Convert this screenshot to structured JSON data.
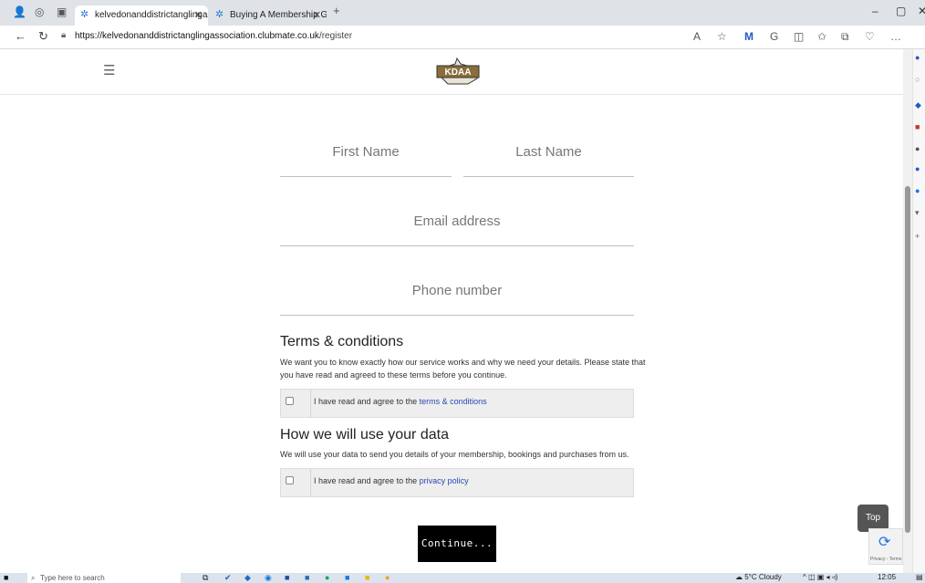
{
  "browser": {
    "tabs": [
      {
        "title": "kelvedonanddistrictanglingassoc"
      },
      {
        "title": "Buying A Membership Guide | C"
      }
    ],
    "new_tab": "+",
    "url_host": "https://kelvedonanddistrictanglingassociation.clubmate.co.uk",
    "url_path": "/register",
    "window": {
      "minimize": "–",
      "maximize": "▢",
      "close": "✕"
    }
  },
  "site": {
    "logo_text": "KDAA",
    "menu_icon": "hamburger-menu-icon"
  },
  "form": {
    "first_name_placeholder": "First Name",
    "last_name_placeholder": "Last Name",
    "email_placeholder": "Email address",
    "phone_placeholder": "Phone number"
  },
  "terms": {
    "heading": "Terms & conditions",
    "body": "We want you to know exactly how our service works and why we need your details. Please state that you have read and agreed to these terms before you continue.",
    "checkbox_prefix": "I have read and agree to the ",
    "checkbox_link": "terms & conditions",
    "checked": false
  },
  "data_use": {
    "heading": "How we will use your data",
    "body": "We will use your data to send you details of your membership, bookings and purchases from us.",
    "checkbox_prefix": "I have read and agree to the ",
    "checkbox_link": "privacy policy",
    "checked": false
  },
  "buttons": {
    "continue": "Continue...",
    "top": "Top"
  },
  "recaptcha": {
    "text": "Privacy - Terms"
  },
  "taskbar": {
    "search_placeholder": "Type here to search",
    "weather": "5°C Cloudy",
    "time": "12:05"
  },
  "colors": {
    "link": "#2a47b5",
    "button_bg": "#000000",
    "checkbox_row_bg": "#eeeeee",
    "top_button_bg": "#555555"
  }
}
